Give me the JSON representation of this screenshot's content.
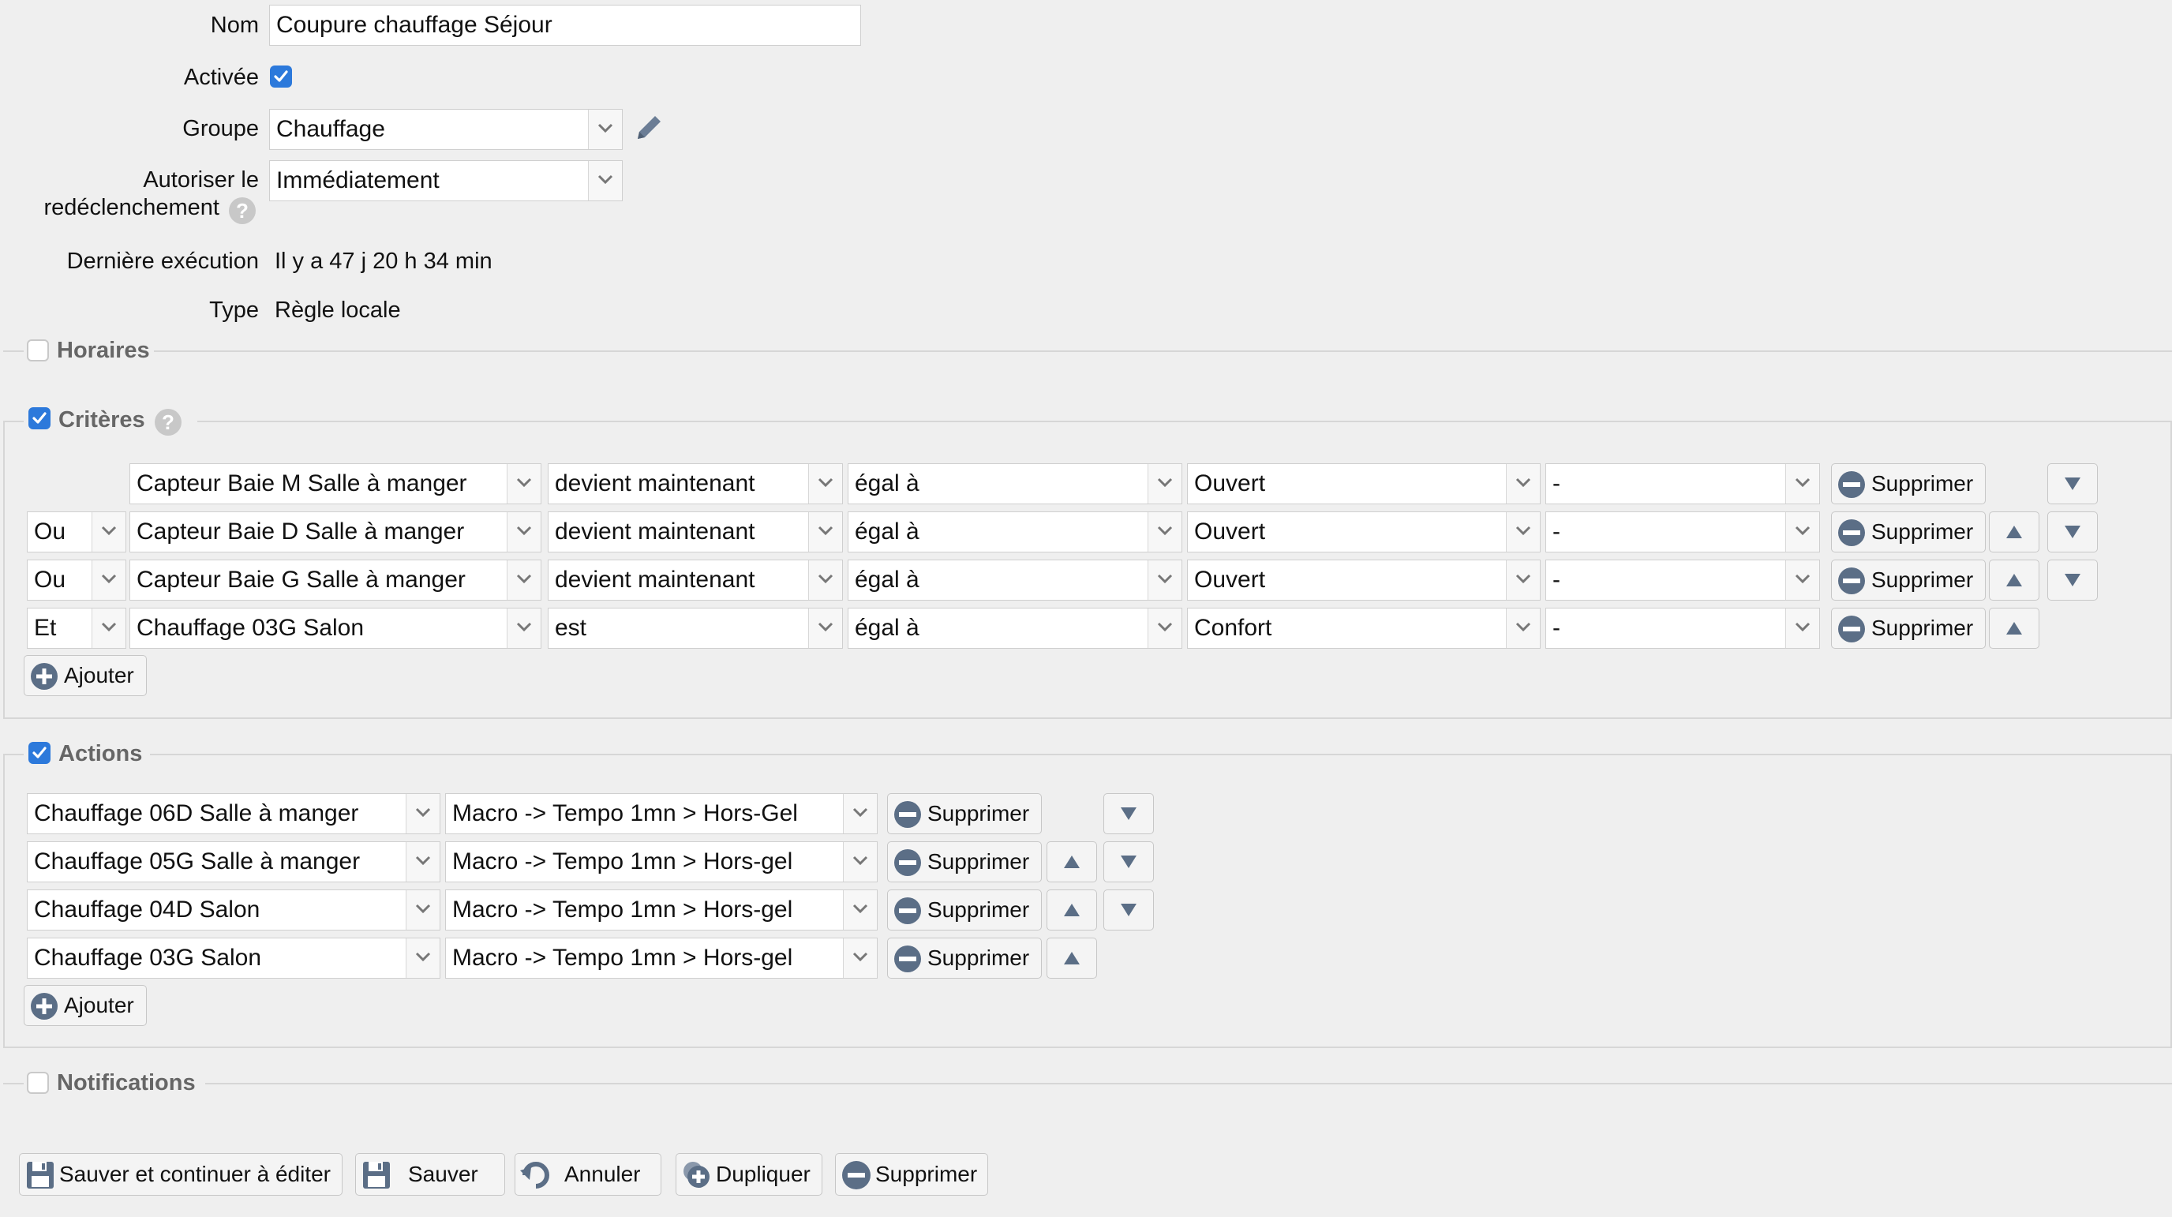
{
  "form": {
    "name_label": "Nom",
    "name_value": "Coupure chauffage Séjour",
    "enabled_label": "Activée",
    "group_label": "Groupe",
    "group_value": "Chauffage",
    "retrigger_label_1": "Autoriser le",
    "retrigger_label_2": "redéclenchement",
    "retrigger_value": "Immédiatement",
    "last_exec_label": "Dernière exécution",
    "last_exec_value": "Il y a 47 j 20 h 34 min",
    "type_label": "Type",
    "type_value": "Règle locale",
    "help_glyph": "?"
  },
  "sections": {
    "schedules": "Horaires",
    "criteria": "Critères",
    "actions": "Actions",
    "notifications": "Notifications"
  },
  "criteria": [
    {
      "conj": "",
      "device": "Capteur Baie M Salle à manger",
      "mode": "devient maintenant",
      "op": "égal à",
      "value": "Ouvert",
      "extra": "-",
      "delete": "Supprimer"
    },
    {
      "conj": "Ou",
      "device": "Capteur Baie D Salle à manger",
      "mode": "devient maintenant",
      "op": "égal à",
      "value": "Ouvert",
      "extra": "-",
      "delete": "Supprimer"
    },
    {
      "conj": "Ou",
      "device": "Capteur Baie G Salle à manger",
      "mode": "devient maintenant",
      "op": "égal à",
      "value": "Ouvert",
      "extra": "-",
      "delete": "Supprimer"
    },
    {
      "conj": "Et",
      "device": "Chauffage 03G Salon",
      "mode": "est",
      "op": "égal à",
      "value": "Confort",
      "extra": "-",
      "delete": "Supprimer"
    }
  ],
  "criteria_add": "Ajouter",
  "actions": [
    {
      "device": "Chauffage 06D Salle à manger",
      "macro": "Macro -> Tempo 1mn > Hors-Gel",
      "delete": "Supprimer"
    },
    {
      "device": "Chauffage 05G Salle à manger",
      "macro": "Macro -> Tempo 1mn > Hors-gel",
      "delete": "Supprimer"
    },
    {
      "device": "Chauffage 04D Salon",
      "macro": "Macro -> Tempo 1mn > Hors-gel",
      "delete": "Supprimer"
    },
    {
      "device": "Chauffage 03G Salon",
      "macro": "Macro -> Tempo 1mn > Hors-gel",
      "delete": "Supprimer"
    }
  ],
  "actions_add": "Ajouter",
  "footer": {
    "save_continue": "Sauver et continuer à éditer",
    "save": "Sauver",
    "cancel": "Annuler",
    "duplicate": "Dupliquer",
    "delete": "Supprimer"
  },
  "colors": {
    "accent": "#2c79db",
    "icon": "#5b6e86"
  }
}
